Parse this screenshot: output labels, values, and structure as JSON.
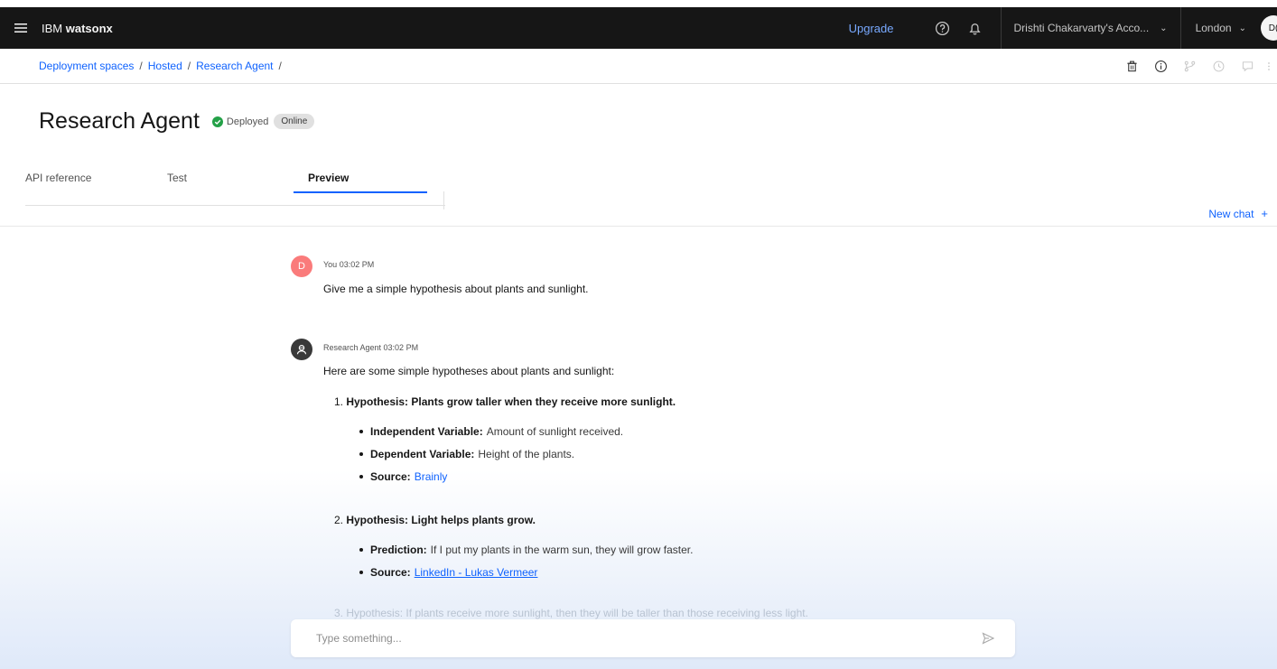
{
  "header": {
    "brand_prefix": "IBM",
    "brand_name": "watsonx",
    "upgrade": "Upgrade",
    "account": "Drishti Chakarvarty's Acco...",
    "region": "London",
    "avatar_initials": "D("
  },
  "breadcrumb": [
    "Deployment spaces",
    "Hosted",
    "Research Agent"
  ],
  "page": {
    "title": "Research Agent",
    "status": "Deployed",
    "tag": "Online"
  },
  "tabs": [
    "API reference",
    "Test",
    "Preview"
  ],
  "active_tab": "Preview",
  "new_chat": "New chat",
  "chat": {
    "user": {
      "initial": "D",
      "meta": "You 03:02 PM",
      "text": "Give me a simple hypothesis about plants and sunlight."
    },
    "agent": {
      "meta": "Research Agent 03:02 PM",
      "intro": "Here are some simple hypotheses about plants and sunlight:",
      "items": [
        {
          "number": "1.",
          "heading": "Hypothesis: Plants grow taller when they receive more sunlight.",
          "bullets": [
            {
              "label": "Independent Variable:",
              "text": "Amount of sunlight received."
            },
            {
              "label": "Dependent Variable:",
              "text": "Height of the plants."
            },
            {
              "label": "Source:",
              "link": "Brainly"
            }
          ]
        },
        {
          "number": "2.",
          "heading": "Hypothesis: Light helps plants grow.",
          "bullets": [
            {
              "label": "Prediction:",
              "text": "If I put my plants in the warm sun, they will grow faster."
            },
            {
              "label": "Source:",
              "link": "LinkedIn - Lukas Vermeer"
            }
          ]
        },
        {
          "number": "3.",
          "heading": "Hypothesis: If plants receive more sunlight, then they will be taller than those receiving less light."
        }
      ]
    }
  },
  "input": {
    "placeholder": "Type something..."
  },
  "colors": {
    "header_bg": "#161616",
    "link": "#0f62fe",
    "status_green": "#24a148",
    "user_avatar": "#fa7b7b"
  }
}
